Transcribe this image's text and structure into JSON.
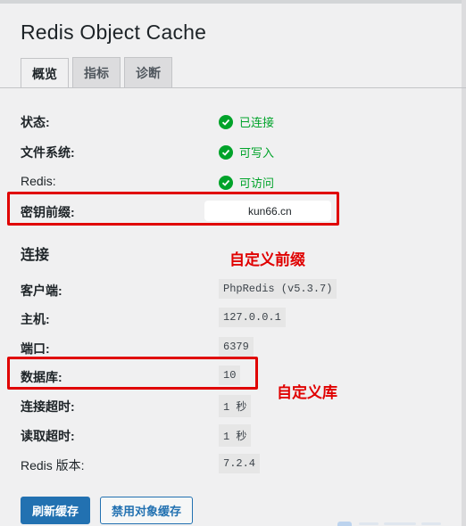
{
  "page": {
    "title": "Redis Object Cache"
  },
  "tabs": [
    {
      "label": "概览",
      "active": true
    },
    {
      "label": "指标",
      "active": false
    },
    {
      "label": "诊断",
      "active": false
    }
  ],
  "overview": {
    "status": {
      "label": "状态:",
      "value": "已连接"
    },
    "filesystem": {
      "label": "文件系统:",
      "value": "可写入"
    },
    "redis": {
      "label": "Redis:",
      "value": "可访问"
    },
    "key_prefix": {
      "label": "密钥前缀:",
      "value": "kun66.cn"
    }
  },
  "connection": {
    "title": "连接",
    "client": {
      "label": "客户端:",
      "value": "PhpRedis (v5.3.7)"
    },
    "host": {
      "label": "主机:",
      "value": "127.0.0.1"
    },
    "port": {
      "label": "端口:",
      "value": "6379"
    },
    "database": {
      "label": "数据库:",
      "value": "10"
    },
    "connect_timeout": {
      "label": "连接超时:",
      "value": "1 秒"
    },
    "read_timeout": {
      "label": "读取超时:",
      "value": "1 秒"
    },
    "redis_version": {
      "label": "Redis 版本:",
      "value": "7.2.4"
    }
  },
  "annotations": {
    "prefix_note": "自定义前缀",
    "database_note": "自定义库"
  },
  "actions": {
    "flush_label": "刷新缓存",
    "disable_label": "禁用对象缓存"
  },
  "colors": {
    "accent": "#2271b1",
    "success": "#00a32a",
    "annotation": "#e00000"
  }
}
